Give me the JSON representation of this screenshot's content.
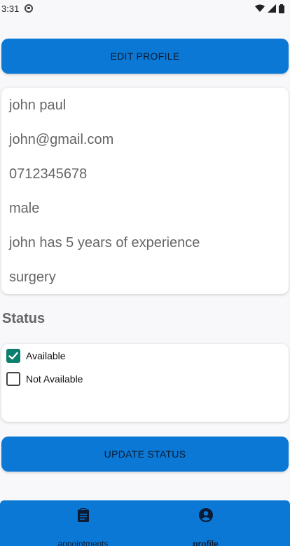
{
  "status_bar": {
    "time": "3:31"
  },
  "buttons": {
    "edit_profile": "EDIT PROFILE",
    "update_status": "UPDATE STATUS"
  },
  "profile": {
    "name": "john paul",
    "email": "john@gmail.com",
    "phone": "0712345678",
    "gender": "male",
    "experience": "john has 5 years of experience",
    "specialty": "surgery"
  },
  "status": {
    "title": "Status",
    "options": [
      {
        "label": "Available",
        "checked": true
      },
      {
        "label": "Not Available",
        "checked": false
      }
    ]
  },
  "bottom_nav": {
    "items": [
      {
        "label": "appointments",
        "icon": "clipboard-icon",
        "active": false
      },
      {
        "label": "profile",
        "icon": "account-circle-icon",
        "active": true
      }
    ]
  },
  "colors": {
    "primary": "#0a78d4",
    "checkbox": "#0a7f6e",
    "background": "#f8f8fa"
  }
}
